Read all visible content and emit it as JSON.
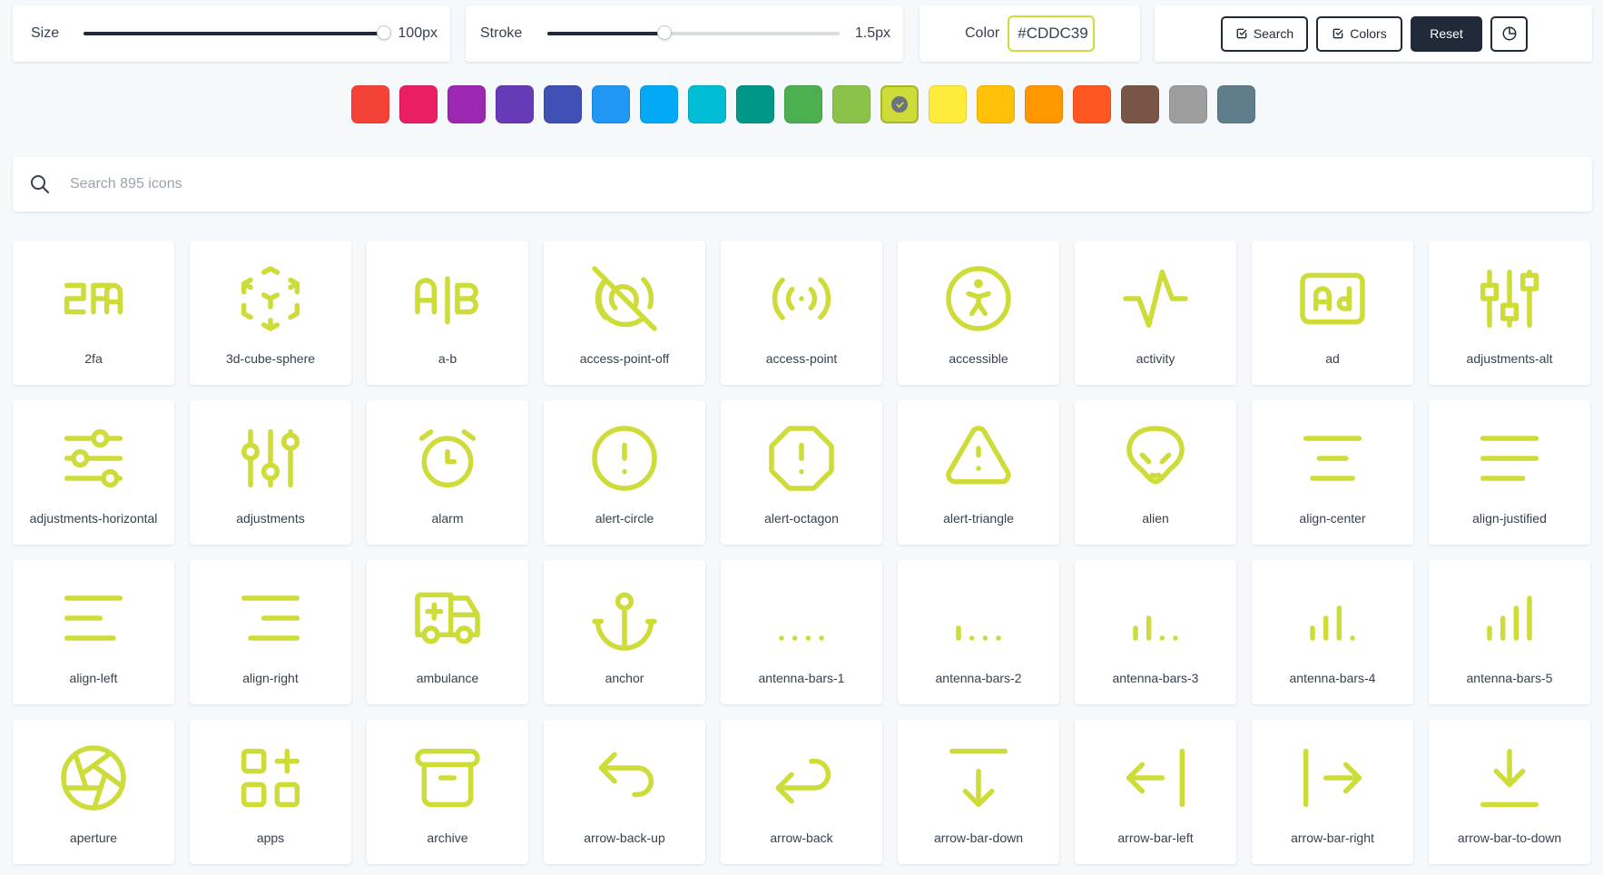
{
  "controls": {
    "size": {
      "label": "Size",
      "value": "100px",
      "level": 1.0
    },
    "stroke": {
      "label": "Stroke",
      "value": "1.5px",
      "level": 0.4
    },
    "color": {
      "label": "Color",
      "value": "#CDDC39"
    },
    "buttons": {
      "search": "Search",
      "colors": "Colors",
      "reset": "Reset"
    }
  },
  "icon_color": "#CDDC39",
  "swatches": [
    "#F44336",
    "#E91E63",
    "#9C27B0",
    "#673AB7",
    "#3F51B5",
    "#2196F3",
    "#03A9F4",
    "#00BCD4",
    "#009688",
    "#4CAF50",
    "#8BC34A",
    "#CDDC39",
    "#FFEB3B",
    "#FFC107",
    "#FF9800",
    "#FF5722",
    "#795548",
    "#9E9E9E",
    "#607D8B"
  ],
  "selected_swatch": 11,
  "search": {
    "placeholder": "Search 895 icons"
  },
  "icons": [
    "2fa",
    "3d-cube-sphere",
    "a-b",
    "access-point-off",
    "access-point",
    "accessible",
    "activity",
    "ad",
    "adjustments-alt",
    "adjustments-horizontal",
    "adjustments",
    "alarm",
    "alert-circle",
    "alert-octagon",
    "alert-triangle",
    "alien",
    "align-center",
    "align-justified",
    "align-left",
    "align-right",
    "ambulance",
    "anchor",
    "antenna-bars-1",
    "antenna-bars-2",
    "antenna-bars-3",
    "antenna-bars-4",
    "antenna-bars-5",
    "aperture",
    "apps",
    "archive",
    "arrow-back-up",
    "arrow-back",
    "arrow-bar-down",
    "arrow-bar-left",
    "arrow-bar-right",
    "arrow-bar-to-down"
  ]
}
